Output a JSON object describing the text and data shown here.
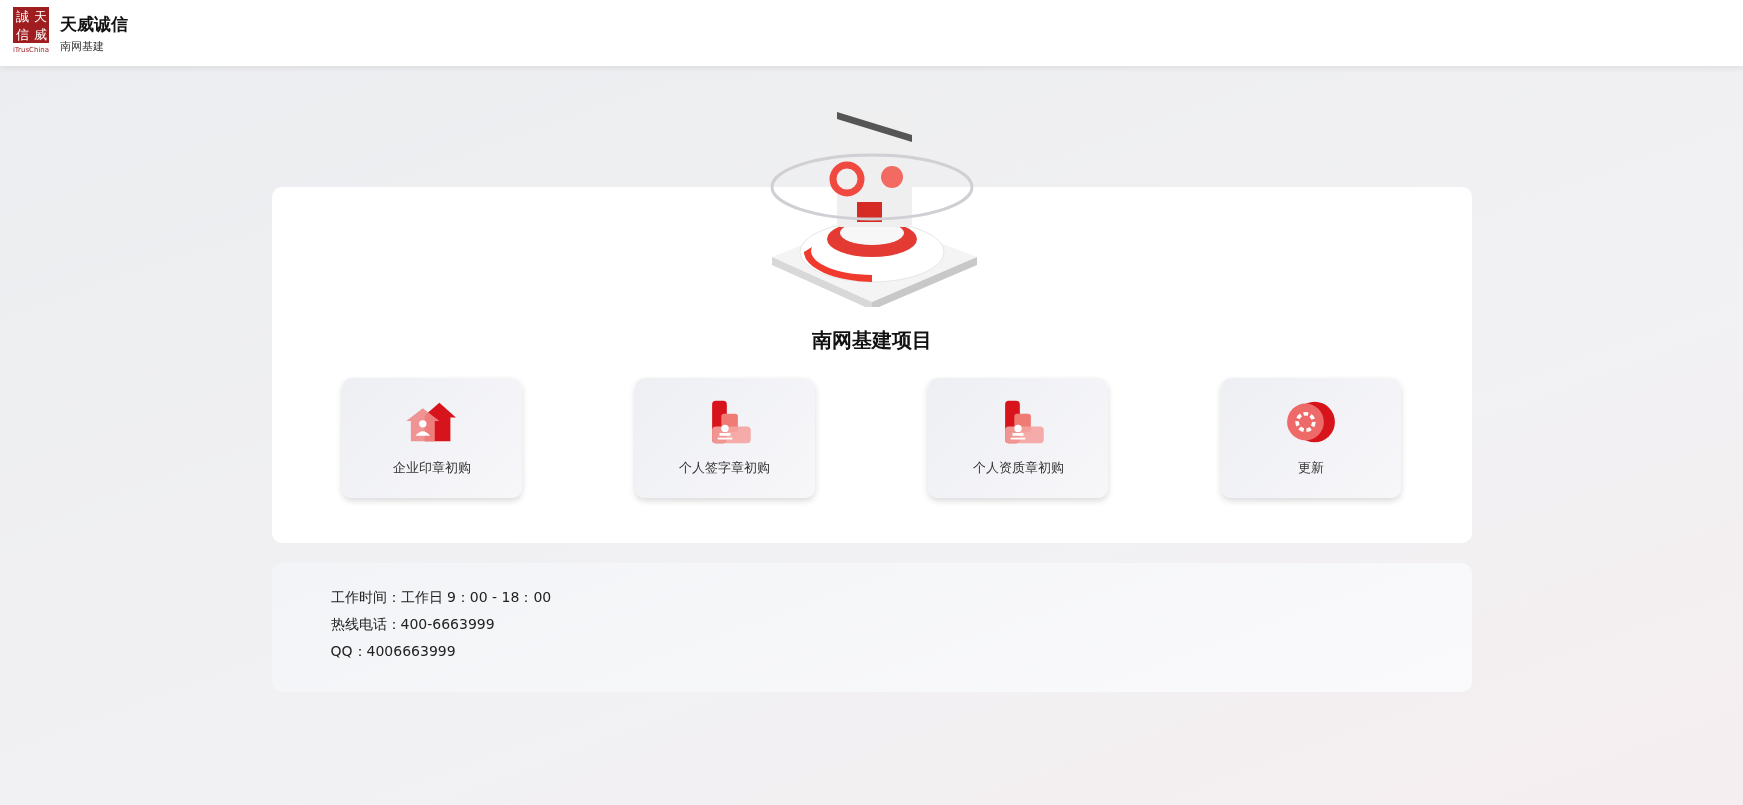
{
  "header": {
    "logo": {
      "chars": [
        "誠",
        "天",
        "信",
        "威"
      ],
      "brand": "iTrusChina"
    },
    "title": "天威诚信",
    "subtitle": "南网基建"
  },
  "project": {
    "title": "南网基建项目",
    "tiles": [
      {
        "label": "企业印章初购",
        "kind": "house"
      },
      {
        "label": "个人签字章初购",
        "kind": "stamp"
      },
      {
        "label": "个人资质章初购",
        "kind": "stamp"
      },
      {
        "label": "更新",
        "kind": "disc"
      }
    ]
  },
  "contact": [
    "工作时间：工作日 9：00 - 18：00",
    "热线电话：400-6663999",
    "QQ：4006663999"
  ]
}
